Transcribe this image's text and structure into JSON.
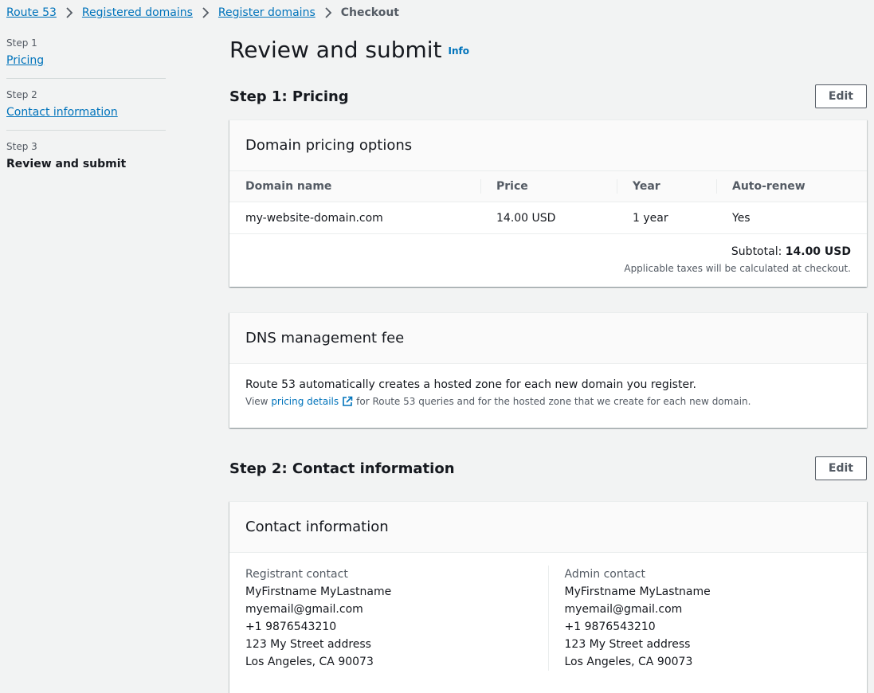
{
  "breadcrumb": {
    "items": [
      "Route 53",
      "Registered domains",
      "Register domains"
    ],
    "current": "Checkout"
  },
  "steps": [
    {
      "num": "Step 1",
      "label": "Pricing"
    },
    {
      "num": "Step 2",
      "label": "Contact information"
    },
    {
      "num": "Step 3",
      "label": "Review and submit"
    }
  ],
  "page": {
    "title": "Review and submit",
    "info": "Info"
  },
  "step1": {
    "heading": "Step 1: Pricing",
    "edit_label": "Edit",
    "pricing_card": {
      "title": "Domain pricing options",
      "columns": [
        "Domain name",
        "Price",
        "Year",
        "Auto-renew"
      ],
      "rows": [
        [
          "my-website-domain.com",
          "14.00 USD",
          "1 year",
          "Yes"
        ]
      ],
      "subtotal_label": "Subtotal:",
      "subtotal_value": "14.00 USD",
      "tax_note": "Applicable taxes will be calculated at checkout."
    },
    "dns_card": {
      "title": "DNS management fee",
      "text": "Route 53 automatically creates a hosted zone for each new domain you register.",
      "sub_prefix": "View",
      "sub_link": "pricing details",
      "sub_suffix": "for Route 53 queries and for the hosted zone that we create for each new domain."
    }
  },
  "step2": {
    "heading": "Step 2: Contact information",
    "edit_label": "Edit",
    "card_title": "Contact information",
    "registrant": {
      "title": "Registrant contact",
      "name": "MyFirstname MyLastname",
      "email": "myemail@gmail.com",
      "phone": "+1 9876543210",
      "address": "123 My Street address",
      "city": "Los Angeles, CA 90073"
    },
    "admin": {
      "title": "Admin contact",
      "name": "MyFirstname MyLastname",
      "email": "myemail@gmail.com",
      "phone": "+1 9876543210",
      "address": "123 My Street address",
      "city": "Los Angeles, CA 90073"
    }
  },
  "colors": {
    "link": "#0073bb",
    "text": "#16191f",
    "muted": "#545b64",
    "background": "#f2f3f3"
  }
}
